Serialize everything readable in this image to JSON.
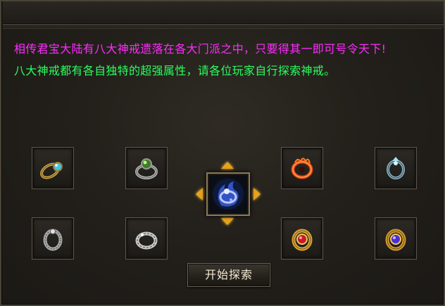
{
  "description": {
    "line1": "相传君宝大陆有八大神戒遗落在各大门派之中，只要得其一即可号令天下!",
    "line2": "八大神戒都有各自独特的超强属性，请各位玩家自行探索神戒。",
    "line1_color": "#ff2cff",
    "line2_color": "#29ff5e"
  },
  "rings": [
    {
      "icon": "gold-ring-blue-gem-icon"
    },
    {
      "icon": "silver-ring-green-gem-icon"
    },
    {
      "icon": "fire-ring-icon"
    },
    {
      "icon": "ice-ring-icon"
    },
    {
      "icon": "silver-ornate-ring-icon"
    },
    {
      "icon": "silver-ring-icon"
    },
    {
      "icon": "gold-ring-red-gem-icon"
    },
    {
      "icon": "gold-ring-purple-gem-icon"
    }
  ],
  "center": {
    "icon": "blue-flame-ring-icon"
  },
  "start_button": {
    "label": "开始探索"
  }
}
